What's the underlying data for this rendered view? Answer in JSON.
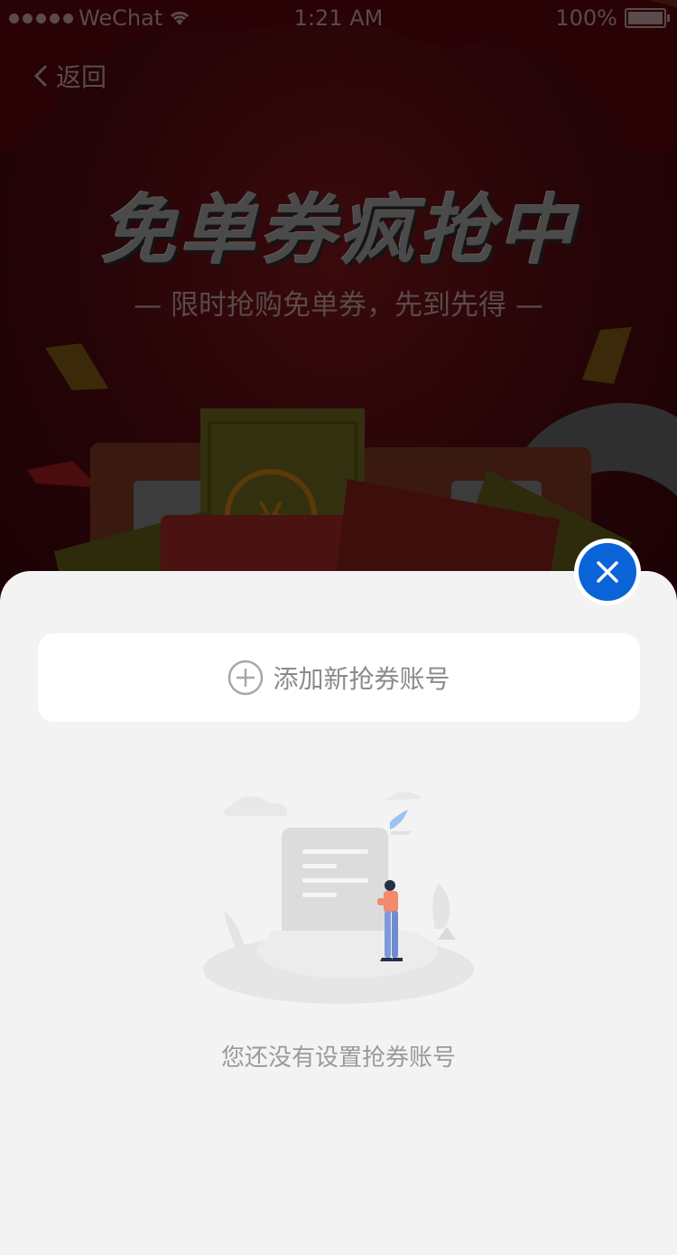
{
  "status_bar": {
    "carrier": "WeChat",
    "time": "1:21 AM",
    "battery": "100%"
  },
  "nav": {
    "back_label": "返回"
  },
  "hero": {
    "title": "免单券疯抢中",
    "subtitle": "— 限时抢购免单券，先到先得 —"
  },
  "sheet": {
    "add_account_label": "添加新抢券账号",
    "empty_message": "您还没有设置抢券账号"
  },
  "colors": {
    "accent_blue": "#0a64d8",
    "sheet_bg": "#f3f3f3",
    "card_bg": "#ffffff"
  }
}
